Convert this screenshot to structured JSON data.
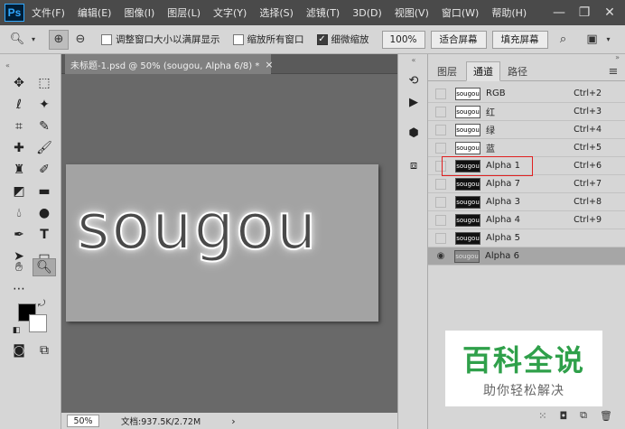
{
  "app": {
    "logo": "Ps"
  },
  "menu": [
    "文件(F)",
    "编辑(E)",
    "图像(I)",
    "图层(L)",
    "文字(Y)",
    "选择(S)",
    "滤镜(T)",
    "3D(D)",
    "视图(V)",
    "窗口(W)",
    "帮助(H)"
  ],
  "window_controls": {
    "minimize": "—",
    "restore": "❐",
    "close": "✕"
  },
  "options": {
    "resize_windows_label": "调整窗口大小以满屏显示",
    "zoom_all_label": "缩放所有窗口",
    "scrubby_zoom_label": "细微缩放",
    "zoom_100": "100%",
    "fit_screen": "适合屏幕",
    "fill_screen": "填充屏幕"
  },
  "document": {
    "tab_title": "未标题-1.psd @ 50% (sougou, Alpha 6/8) *",
    "tab_close": "×",
    "canvas_text": "sougou"
  },
  "status": {
    "zoom": "50%",
    "doc_info": "文档:937.5K/2.72M",
    "arrow": "›"
  },
  "panel": {
    "tabs": [
      "图层",
      "通道",
      "路径"
    ],
    "active_tab": "通道",
    "menu_icon": "≡",
    "channels": [
      {
        "name": "RGB",
        "shortcut": "Ctrl+2",
        "thumb": "sougou",
        "thumb_style": "white"
      },
      {
        "name": "红",
        "shortcut": "Ctrl+3",
        "thumb": "sougou",
        "thumb_style": "white"
      },
      {
        "name": "绿",
        "shortcut": "Ctrl+4",
        "thumb": "sougou",
        "thumb_style": "white"
      },
      {
        "name": "蓝",
        "shortcut": "Ctrl+5",
        "thumb": "sougou",
        "thumb_style": "white"
      },
      {
        "name": "Alpha 1",
        "shortcut": "Ctrl+6",
        "thumb": "sougou",
        "thumb_style": "black"
      },
      {
        "name": "Alpha 7",
        "shortcut": "Ctrl+7",
        "thumb": "sougou",
        "thumb_style": "black"
      },
      {
        "name": "Alpha 3",
        "shortcut": "Ctrl+8",
        "thumb": "sougou",
        "thumb_style": "black"
      },
      {
        "name": "Alpha 4",
        "shortcut": "Ctrl+9",
        "thumb": "sougou",
        "thumb_style": "black"
      },
      {
        "name": "Alpha 5",
        "shortcut": "",
        "thumb": "sougou",
        "thumb_style": "black"
      },
      {
        "name": "Alpha 6",
        "shortcut": "",
        "thumb": "sougou",
        "thumb_style": "gray"
      }
    ]
  },
  "watermark": {
    "title": "百科全说",
    "subtitle": "助你轻松解决"
  },
  "colors": {
    "accent_green": "#2fa04a",
    "highlight_red": "#e02020",
    "ps_blue": "#31a8ff"
  }
}
